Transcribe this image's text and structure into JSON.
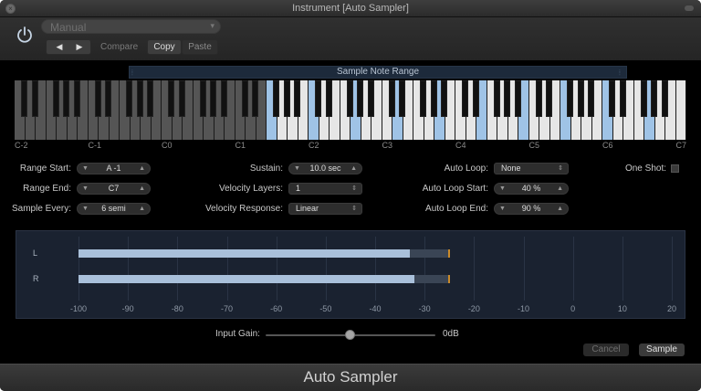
{
  "window": {
    "title": "Instrument [Auto Sampler]"
  },
  "header": {
    "preset": "Manual",
    "compare": "Compare",
    "copy": "Copy",
    "paste": "Paste",
    "prev_glyph": "◀",
    "next_glyph": "▶"
  },
  "range": {
    "label": "Sample Note Range",
    "start_index": 24,
    "end_index": 66
  },
  "keyboard": {
    "octaves": [
      "C-2",
      "C-1",
      "C0",
      "C1",
      "C2",
      "C3",
      "C4",
      "C5",
      "C6",
      "C7"
    ],
    "white_count": 64,
    "accent": "#9fc3e6"
  },
  "params": {
    "range_start": {
      "label": "Range Start:",
      "value": "A -1"
    },
    "range_end": {
      "label": "Range End:",
      "value": "C7"
    },
    "sample_every": {
      "label": "Sample Every:",
      "value": "6 semi"
    },
    "sustain": {
      "label": "Sustain:",
      "value": "10.0 sec"
    },
    "velocity_layers": {
      "label": "Velocity Layers:",
      "value": "1"
    },
    "velocity_response": {
      "label": "Velocity Response:",
      "value": "Linear"
    },
    "auto_loop": {
      "label": "Auto Loop:",
      "value": "None"
    },
    "auto_loop_start": {
      "label": "Auto Loop Start:",
      "value": "40 %"
    },
    "auto_loop_end": {
      "label": "Auto Loop End:",
      "value": "90 %"
    },
    "one_shot": {
      "label": "One Shot:",
      "checked": false
    }
  },
  "meter": {
    "channels": [
      {
        "label": "L",
        "level_db": -33,
        "peak_db": -25
      },
      {
        "label": "R",
        "level_db": -32,
        "peak_db": -25
      }
    ],
    "scale": [
      "-100",
      "-90",
      "-80",
      "-70",
      "-60",
      "-50",
      "-40",
      "-30",
      "-20",
      "-10",
      "0",
      "10",
      "20"
    ],
    "min_db": -100,
    "max_db": 20
  },
  "input_gain": {
    "label": "Input Gain:",
    "value": "0dB",
    "position": 0.5
  },
  "buttons": {
    "cancel": "Cancel",
    "sample": "Sample"
  },
  "footer": {
    "name": "Auto Sampler"
  }
}
